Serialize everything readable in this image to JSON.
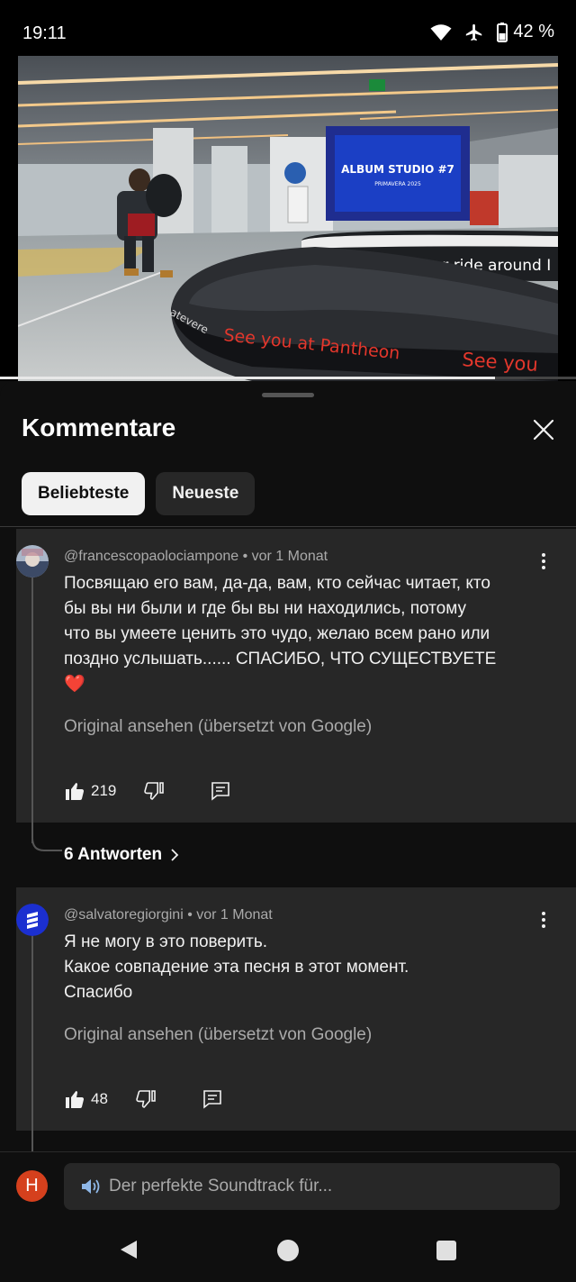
{
  "status_bar": {
    "time": "19:11",
    "battery": "42 %"
  },
  "video": {
    "scene": {
      "screen_title": "ALBUM STUDIO #7",
      "screen_subtitle": "PRIMAVERA 2025",
      "carousel_text": "Your ride around I",
      "belt_text": "See you at Pantheon",
      "belt_text_2": "See you",
      "belt_text_3": "atevere"
    },
    "progress": 0.86
  },
  "comments_sheet": {
    "title": "Kommentare",
    "tabs": [
      {
        "label": "Beliebteste",
        "active": true
      },
      {
        "label": "Neueste",
        "active": false
      }
    ],
    "comments": [
      {
        "meta": "@francescopaolociampone • vor 1 Monat",
        "text_lines": [
          "Посвящаю его вам, да-да, вам, кто сейчас читает, кто",
          "бы вы ни были и где бы вы ни находились, потому",
          "что вы умеете ценить это чудо, желаю всем рано или",
          "поздно услышать...... СПАСИБО, ЧТО СУЩЕСТВУЕТЕ"
        ],
        "emoji": "❤️",
        "translate_link": "Original ansehen (übersetzt von Google)",
        "likes": "219"
      },
      {
        "meta": "@salvatoregiorgini • vor 1 Monat",
        "text_lines": [
          "Я не могу в это поверить.",
          "Какое совпадение эта песня в этот момент.",
          "Спасибо"
        ],
        "translate_link": "Original ansehen (übersetzt von Google)",
        "likes": "48"
      }
    ],
    "replies_link": "6 Antworten",
    "input": {
      "avatar_letter": "H",
      "placeholder": "Der perfekte Soundtrack für..."
    }
  },
  "colors": {
    "background": "#0f0f0f",
    "card": "#272727",
    "text": "#f1f1f1",
    "secondary_text": "#aaaaaa",
    "user_avatar": "#d5401d",
    "heart": "#e53935"
  },
  "icons": [
    "wifi-icon",
    "airplane-icon",
    "battery-icon",
    "close-icon",
    "kebab-menu-icon",
    "thumbs-up-icon",
    "thumbs-down-icon",
    "reply-icon",
    "chevron-right-icon",
    "speaker-icon",
    "back-icon",
    "home-icon",
    "recents-icon"
  ]
}
